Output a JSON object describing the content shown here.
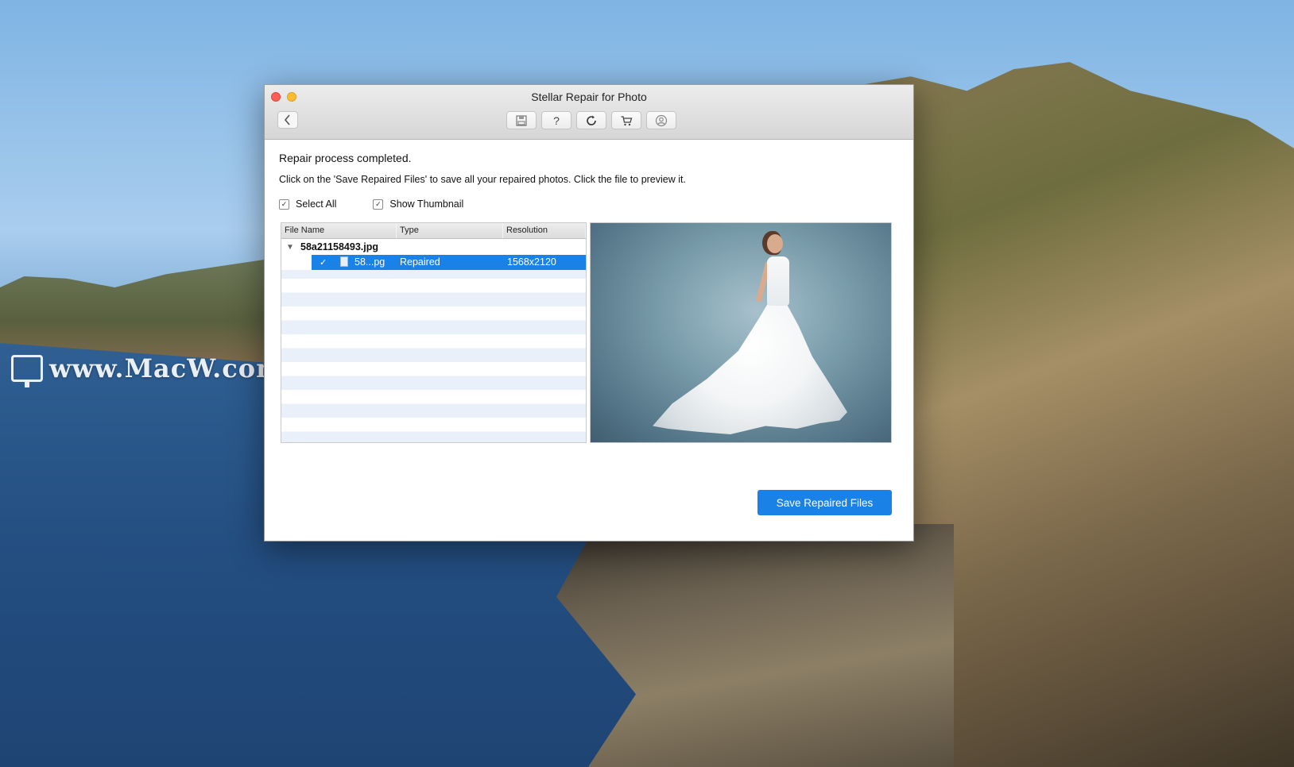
{
  "desktop": {
    "watermark": "www.MacW.com"
  },
  "window": {
    "title": "Stellar Repair for Photo",
    "back_icon": "chevron-left-icon",
    "toolbar_icons": [
      "save-icon",
      "help-icon",
      "refresh-icon",
      "cart-icon",
      "account-icon"
    ],
    "help_glyph": "?"
  },
  "main": {
    "heading": "Repair process completed.",
    "instruction": "Click on the 'Save Repaired Files' to save all your repaired photos. Click the file to preview it.",
    "select_all": {
      "label": "Select All",
      "checked": true
    },
    "show_thumbnail": {
      "label": "Show Thumbnail",
      "checked": true
    },
    "table": {
      "columns": [
        "File Name",
        "Type",
        "Resolution"
      ],
      "parent": "58a21158493.jpg",
      "rows": [
        {
          "checked": true,
          "name": "58...pg",
          "type": "Repaired",
          "resolution": "1568x2120",
          "selected": true
        }
      ]
    },
    "save_button": "Save Repaired Files"
  },
  "colors": {
    "accent": "#1a82e6",
    "close": "#fd5f57",
    "minimize": "#febc2e"
  }
}
